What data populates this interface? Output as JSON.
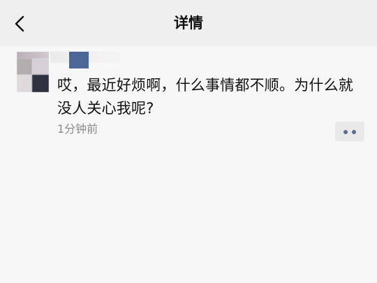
{
  "header": {
    "title": "详情",
    "back_icon": "chevron-left-icon"
  },
  "post": {
    "message": "哎，最近好烦啊，什么事情都不顺。为什么就没人关心我呢?",
    "timestamp": "1分钟前",
    "more_icon": "more-options-icon"
  },
  "colors": {
    "background": "#f7f7f7",
    "header_background": "#efefef",
    "text": "#111111",
    "timestamp": "#8a8a8a",
    "more_button_bg": "#e9e9ea",
    "more_dots": "#5d6b8f",
    "name_blur_accent": "#4d6698"
  }
}
